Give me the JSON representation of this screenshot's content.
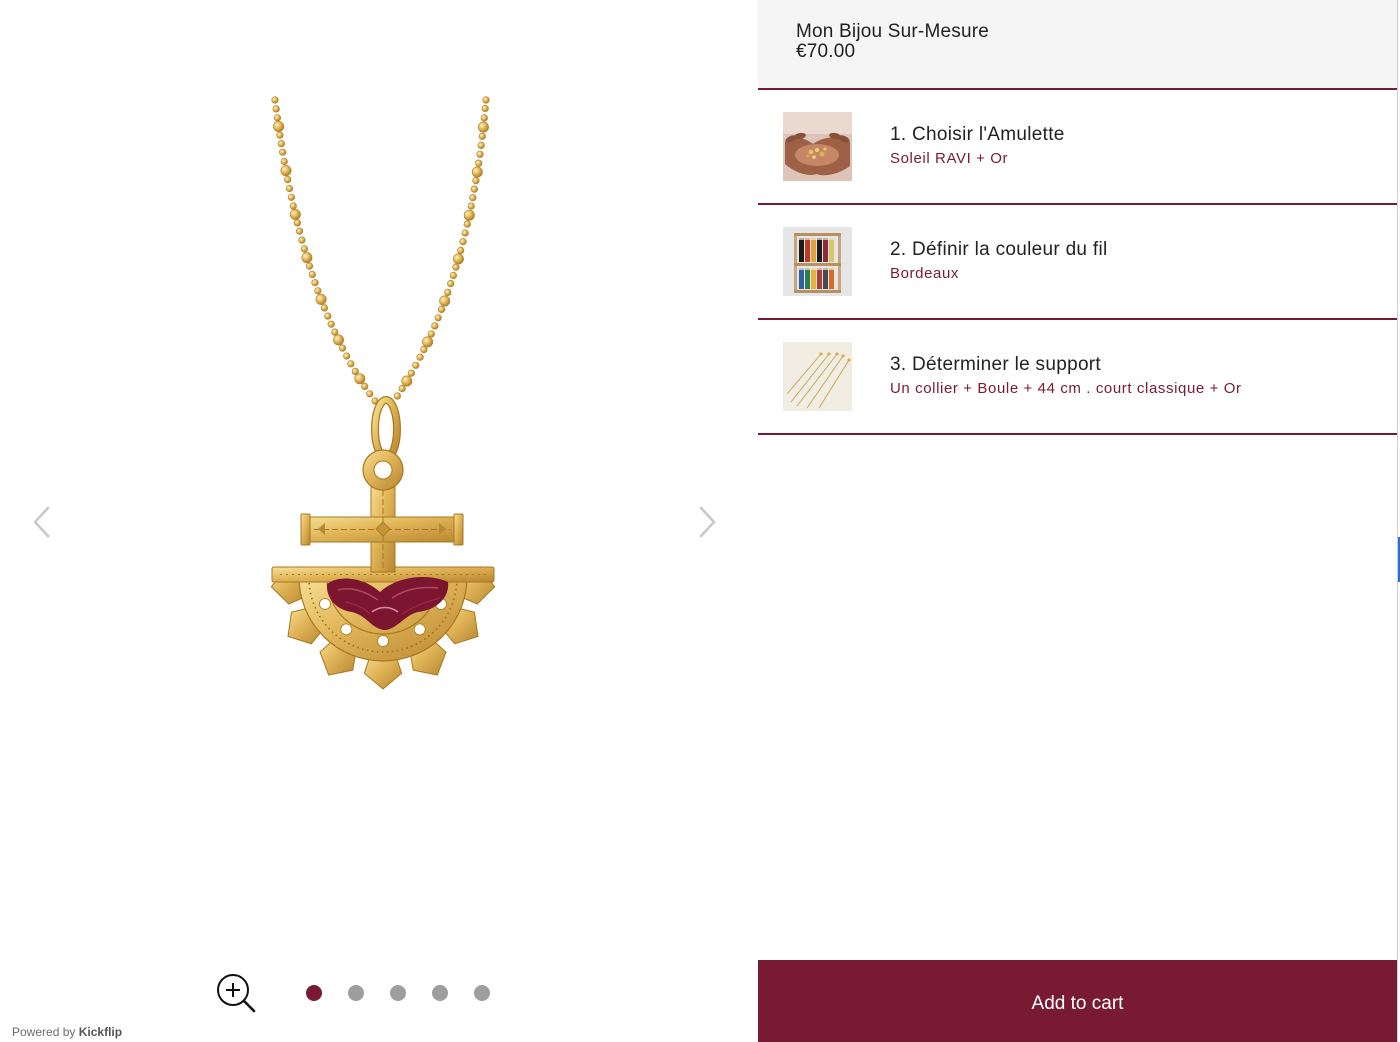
{
  "product": {
    "title": "Mon Bijou Sur-Mesure",
    "price": "€70.00"
  },
  "steps": [
    {
      "title": "1. Choisir l'Amulette",
      "value": "Soleil RAVI + Or",
      "thumbnail": "hands-holding-amulets"
    },
    {
      "title": "2. Définir la couleur du fil",
      "value": "Bordeaux",
      "thumbnail": "thread-spools"
    },
    {
      "title": "3. Déterminer le support",
      "value": "Un collier + Boule + 44 cm . court classique + Or",
      "thumbnail": "gold-chains"
    }
  ],
  "cart": {
    "label": "Add to cart"
  },
  "gallery": {
    "slide_count": 5,
    "active_slide": 1
  },
  "footer": {
    "powered_by": "Powered by",
    "brand": "Kickflip"
  },
  "icons": {
    "prev": "chevron-left-icon",
    "next": "chevron-right-icon",
    "zoom": "zoom-in-icon"
  },
  "colors": {
    "accent": "#781b32",
    "dot_inactive": "#9e9e9e",
    "header_bg": "#f5f5f5",
    "gold": "#e0b457",
    "thread": "#7c1530"
  }
}
